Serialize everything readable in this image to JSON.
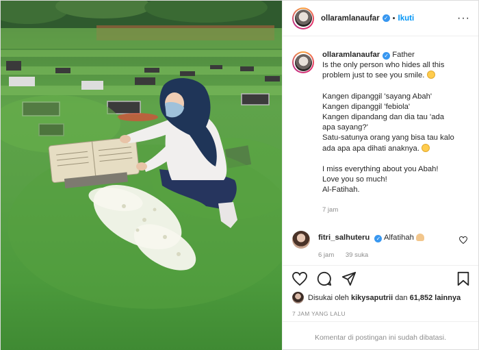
{
  "header": {
    "username": "ollaramlanaufar",
    "separator": "•",
    "follow_label": "Ikuti",
    "more_icon": "more-horizontal-icon"
  },
  "caption": {
    "username": "ollaramlanaufar",
    "lines": [
      "Father",
      "Is the only person who hides all this",
      "problem just to see you smile.",
      "",
      "Kangen dipanggil 'sayang Abah'",
      "Kangen dipanggil 'febiola'",
      "Kangen dipandang dan dia tau 'ada",
      "apa sayang?'",
      "Satu-satunya orang yang bisa tau kalo",
      "ada apa apa dihati anaknya.",
      "",
      "I miss everything about you Abah!",
      "Love you so much!",
      "Al-Fatihah."
    ],
    "time": "7 jam"
  },
  "comment": {
    "username": "fitri_salhuteru",
    "text": "Alfatihah",
    "time": "6 jam",
    "likes": "39 suka"
  },
  "actions": {
    "like_icon": "heart-icon",
    "comment_icon": "comment-icon",
    "share_icon": "share-icon",
    "save_icon": "bookmark-icon"
  },
  "likes": {
    "prefix": "Disukai oleh",
    "user": "kikysaputrii",
    "joiner": "dan",
    "count": "61,852 lainnya"
  },
  "date": "7 JAM YANG LALU",
  "comments_closed": "Komentar di postingan ini sudah dibatasi.",
  "colors": {
    "accent": "#0095f6",
    "verified": "#3897f0",
    "muted": "#8e8e8e"
  }
}
